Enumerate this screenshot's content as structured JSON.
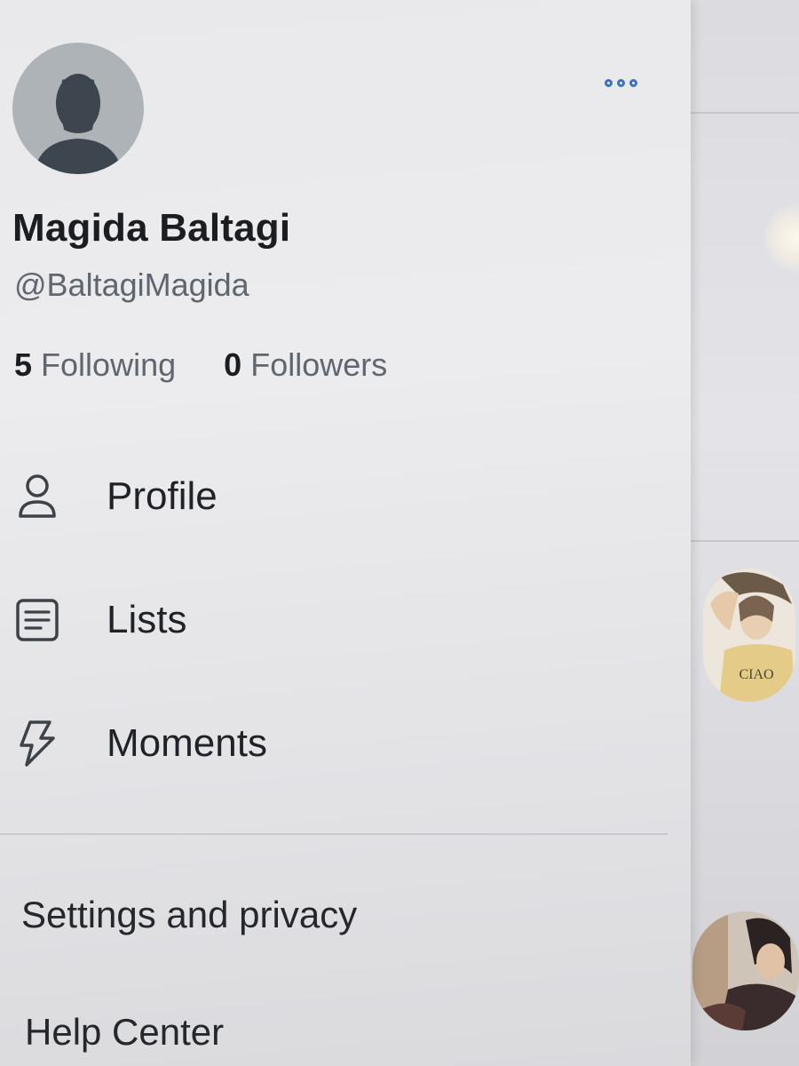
{
  "profile": {
    "display_name": "Magida Baltagi",
    "handle": "@BaltagiMagida",
    "following_count": "5",
    "following_label": "Following",
    "followers_count": "0",
    "followers_label": "Followers"
  },
  "menu": {
    "items": [
      {
        "label": "Profile",
        "icon": "person-icon"
      },
      {
        "label": "Lists",
        "icon": "list-icon"
      },
      {
        "label": "Moments",
        "icon": "lightning-icon"
      }
    ]
  },
  "footer_links": {
    "settings": "Settings and privacy",
    "help": "Help Center"
  },
  "timeline_peek": {
    "shirt_text": "CIAO"
  },
  "colors": {
    "accent": "#3b73c4",
    "text_primary": "#1b1d21",
    "text_secondary": "#5f6670"
  }
}
